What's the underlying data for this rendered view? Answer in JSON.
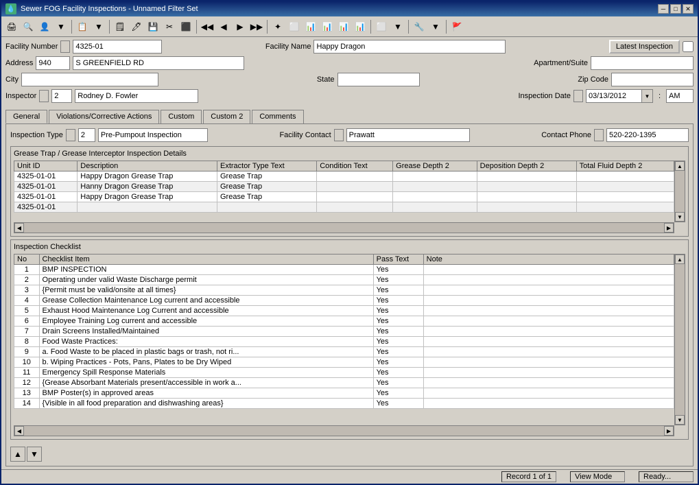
{
  "window": {
    "title": "Sewer FOG Facility Inspections - Unnamed Filter Set"
  },
  "toolbar": {
    "buttons": [
      "🖨",
      "🔍",
      "👤",
      "▼",
      "📋",
      "▼",
      "🖹",
      "🖊",
      "💾",
      "✂",
      "⬛",
      "◀◀",
      "◀",
      "▶",
      "▶▶",
      "✦",
      "⬜",
      "📊",
      "📊",
      "📊",
      "📊",
      "⬜",
      "▼",
      "🔧",
      "▼"
    ]
  },
  "form": {
    "facility_number_label": "Facility Number",
    "facility_number_value": "4325-01",
    "facility_name_label": "Facility Name",
    "facility_name_value": "Happy Dragon",
    "latest_inspection_label": "Latest Inspection",
    "address_label": "Address",
    "address_number": "940",
    "address_street": "S GREENFIELD RD",
    "apartment_suite_label": "Apartment/Suite",
    "city_label": "City",
    "city_value": "",
    "state_label": "State",
    "state_value": "",
    "zip_code_label": "Zip Code",
    "zip_code_value": "",
    "inspector_label": "Inspector",
    "inspector_id": "2",
    "inspector_name": "Rodney D. Fowler",
    "inspection_date_label": "Inspection Date",
    "inspection_date_value": "03/13/2012",
    "time_value": "AM"
  },
  "tabs": [
    {
      "label": "General",
      "active": true
    },
    {
      "label": "Violations/Corrective Actions",
      "active": false
    },
    {
      "label": "Custom",
      "active": false
    },
    {
      "label": "Custom 2",
      "active": false
    },
    {
      "label": "Comments",
      "active": false
    }
  ],
  "inspection_type": {
    "label": "Inspection Type",
    "id": "2",
    "value": "Pre-Pumpout Inspection",
    "facility_contact_label": "Facility Contact",
    "facility_contact_value": "Prawatt",
    "contact_phone_label": "Contact Phone",
    "contact_phone_indicator": "",
    "contact_phone_value": "520-220-1395"
  },
  "grease_trap": {
    "section_title": "Grease Trap / Grease Interceptor Inspection Details",
    "columns": [
      "Unit ID",
      "Description",
      "Extractor Type Text",
      "Condition Text",
      "Grease Depth 2",
      "Deposition Depth 2",
      "Total Fluid Depth 2"
    ],
    "rows": [
      [
        "4325-01-01",
        "Happy Dragon Grease Trap",
        "Grease Trap",
        "",
        "",
        "",
        ""
      ],
      [
        "4325-01-01",
        "Hanny Dragon Grease Trap",
        "Grease Trap",
        "",
        "",
        "",
        ""
      ],
      [
        "4325-01-01",
        "Happy Dragon Grease Trap",
        "Grease Trap",
        "",
        "",
        "",
        ""
      ],
      [
        "4325-01-01",
        "",
        "",
        "",
        "",
        "",
        ""
      ]
    ]
  },
  "checklist": {
    "section_title": "Inspection Checklist",
    "columns": [
      "No",
      "Checklist Item",
      "Pass Text",
      "Note"
    ],
    "rows": [
      {
        "no": "1",
        "item": "BMP INSPECTION",
        "pass": "Yes",
        "note": ""
      },
      {
        "no": "2",
        "item": "Operating under valid Waste Discharge permit",
        "pass": "Yes",
        "note": ""
      },
      {
        "no": "3",
        "item": "{Permit must be valid/onsite at all times}",
        "pass": "Yes",
        "note": ""
      },
      {
        "no": "4",
        "item": "Grease Collection Maintenance Log current and accessible",
        "pass": "Yes",
        "note": ""
      },
      {
        "no": "5",
        "item": "Exhaust Hood Maintenance Log Current and accessible",
        "pass": "Yes",
        "note": ""
      },
      {
        "no": "6",
        "item": "Employee Training Log current and accessible",
        "pass": "Yes",
        "note": ""
      },
      {
        "no": "7",
        "item": "Drain Screens Installed/Maintained",
        "pass": "Yes",
        "note": ""
      },
      {
        "no": "8",
        "item": "Food Waste Practices:",
        "pass": "Yes",
        "note": ""
      },
      {
        "no": "9",
        "item": "a.  Food Waste to be placed in plastic bags or trash, not ri...",
        "pass": "Yes",
        "note": ""
      },
      {
        "no": "10",
        "item": "b.  Wiping Practices - Pots, Pans, Plates to be Dry Wiped",
        "pass": "Yes",
        "note": ""
      },
      {
        "no": "11",
        "item": "Emergency Spill Response Materials",
        "pass": "Yes",
        "note": ""
      },
      {
        "no": "12",
        "item": "{Grease Absorbant Materials present/accessible in work a...",
        "pass": "Yes",
        "note": ""
      },
      {
        "no": "13",
        "item": "BMP Poster(s) in approved areas",
        "pass": "Yes",
        "note": ""
      },
      {
        "no": "14",
        "item": "{Visible in all food preparation and dishwashing areas}",
        "pass": "Yes",
        "note": ""
      }
    ]
  },
  "status_bar": {
    "record": "Record 1 of 1",
    "mode": "View Mode",
    "status": "Ready..."
  }
}
